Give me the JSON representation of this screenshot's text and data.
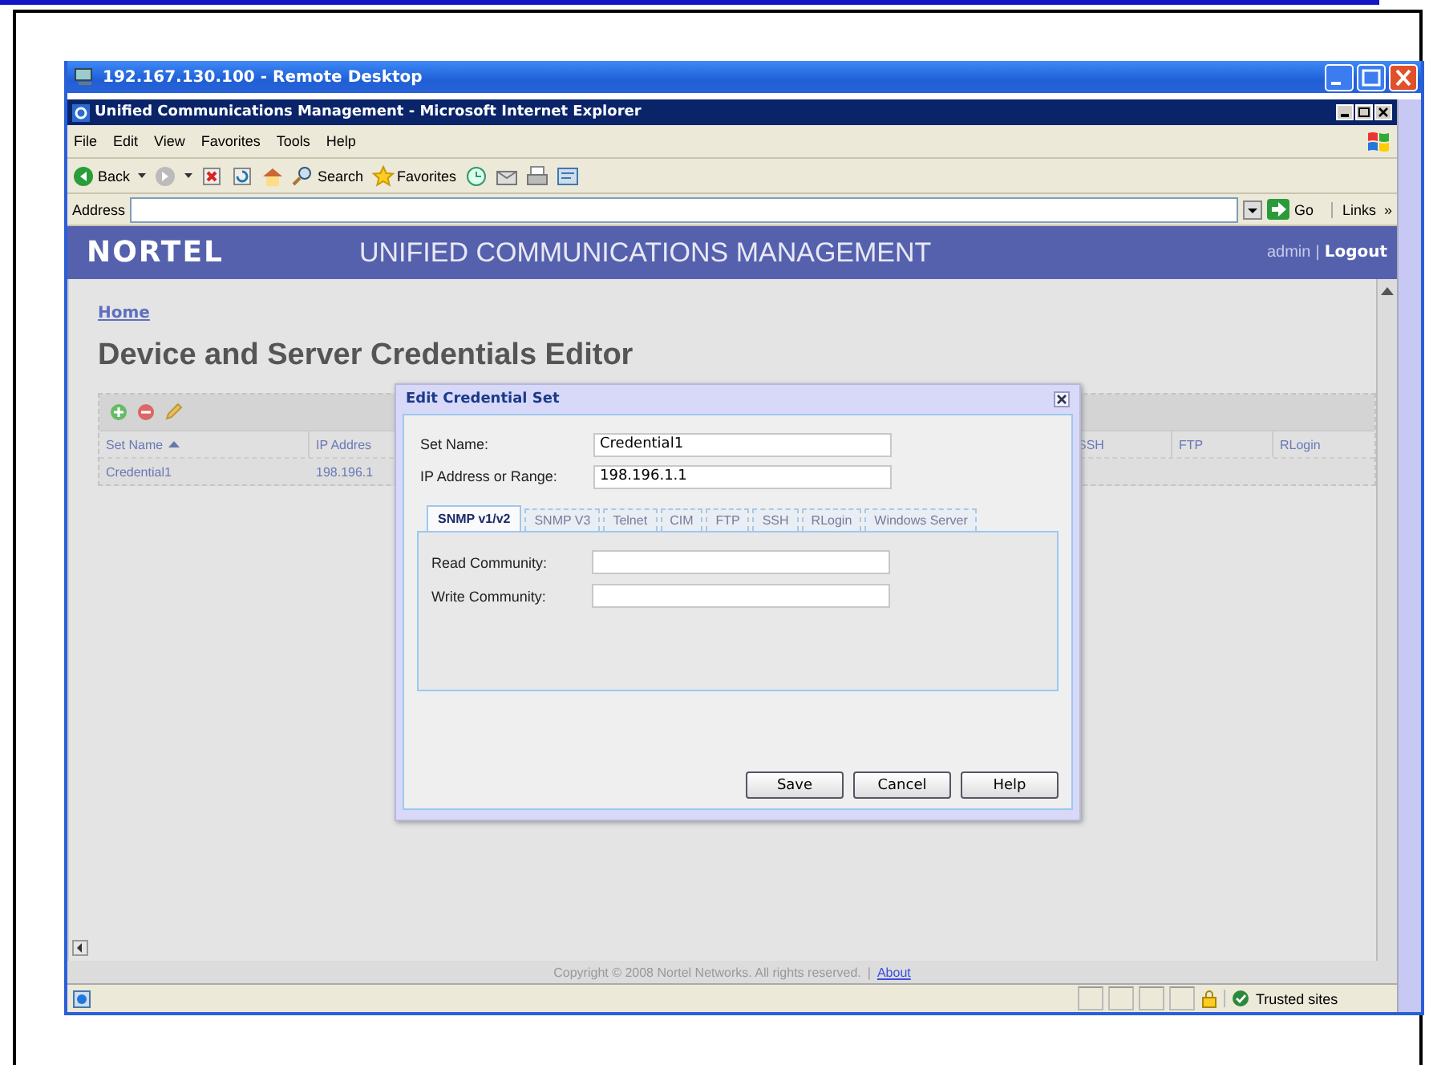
{
  "remote_desktop": {
    "title": "192.167.130.100 - Remote Desktop"
  },
  "browser": {
    "title": "Unified Communications Management - Microsoft Internet Explorer",
    "menu": [
      "File",
      "Edit",
      "View",
      "Favorites",
      "Tools",
      "Help"
    ],
    "toolbar": [
      {
        "kind": "back",
        "label": "Back"
      },
      {
        "kind": "forward"
      },
      {
        "kind": "stop"
      },
      {
        "kind": "refresh"
      },
      {
        "kind": "home"
      },
      {
        "kind": "search",
        "label": "Search"
      },
      {
        "kind": "favorites",
        "label": "Favorites"
      },
      {
        "kind": "history"
      },
      {
        "kind": "mail"
      },
      {
        "kind": "print"
      },
      {
        "kind": "edit"
      }
    ],
    "address": {
      "label": "Address",
      "go": "Go",
      "links": "Links",
      "links_more": "»"
    },
    "status_bar": {
      "zone": "Trusted sites"
    }
  },
  "banner": {
    "logo": "NORTEL",
    "title": "UNIFIED COMMUNICATIONS MANAGEMENT",
    "user": "admin",
    "separator": "|",
    "logout": "Logout"
  },
  "breadcrumb": "Home",
  "heading": "Device and Server Credentials Editor",
  "table": {
    "actions": [
      {
        "kind": "add"
      },
      {
        "kind": "delete"
      },
      {
        "kind": "edit"
      }
    ],
    "columns": [
      {
        "label": "Set Name",
        "sorted": true
      },
      {
        "label": "IP Addres",
        "sorted": false
      },
      {
        "label": "SSH",
        "sorted": false
      },
      {
        "label": "FTP",
        "sorted": false
      },
      {
        "label": "RLogin",
        "sorted": false
      }
    ],
    "rows": [
      {
        "cells": [
          "Credential1",
          "198.196.1"
        ]
      }
    ]
  },
  "footer": {
    "copyright": "Copyright © 2008 Nortel Networks. All rights reserved.",
    "separator": "|",
    "link": "About"
  },
  "dialog": {
    "title": "Edit Credential Set",
    "fields": [
      {
        "label": "Set Name:",
        "value": "Credential1"
      },
      {
        "label": "IP Address or Range:",
        "value": "198.196.1.1"
      }
    ],
    "tabs": [
      {
        "label": "SNMP v1/v2",
        "selected": true
      },
      {
        "label": "SNMP V3",
        "selected": false
      },
      {
        "label": "Telnet",
        "selected": false
      },
      {
        "label": "CIM",
        "selected": false
      },
      {
        "label": "FTP",
        "selected": false
      },
      {
        "label": "SSH",
        "selected": false
      },
      {
        "label": "RLogin",
        "selected": false
      },
      {
        "label": "Windows Server",
        "selected": false
      }
    ],
    "tab_fields": [
      {
        "label": "Read Community:"
      },
      {
        "label": "Write Community:"
      }
    ],
    "buttons": [
      "Save",
      "Cancel",
      "Help"
    ]
  }
}
